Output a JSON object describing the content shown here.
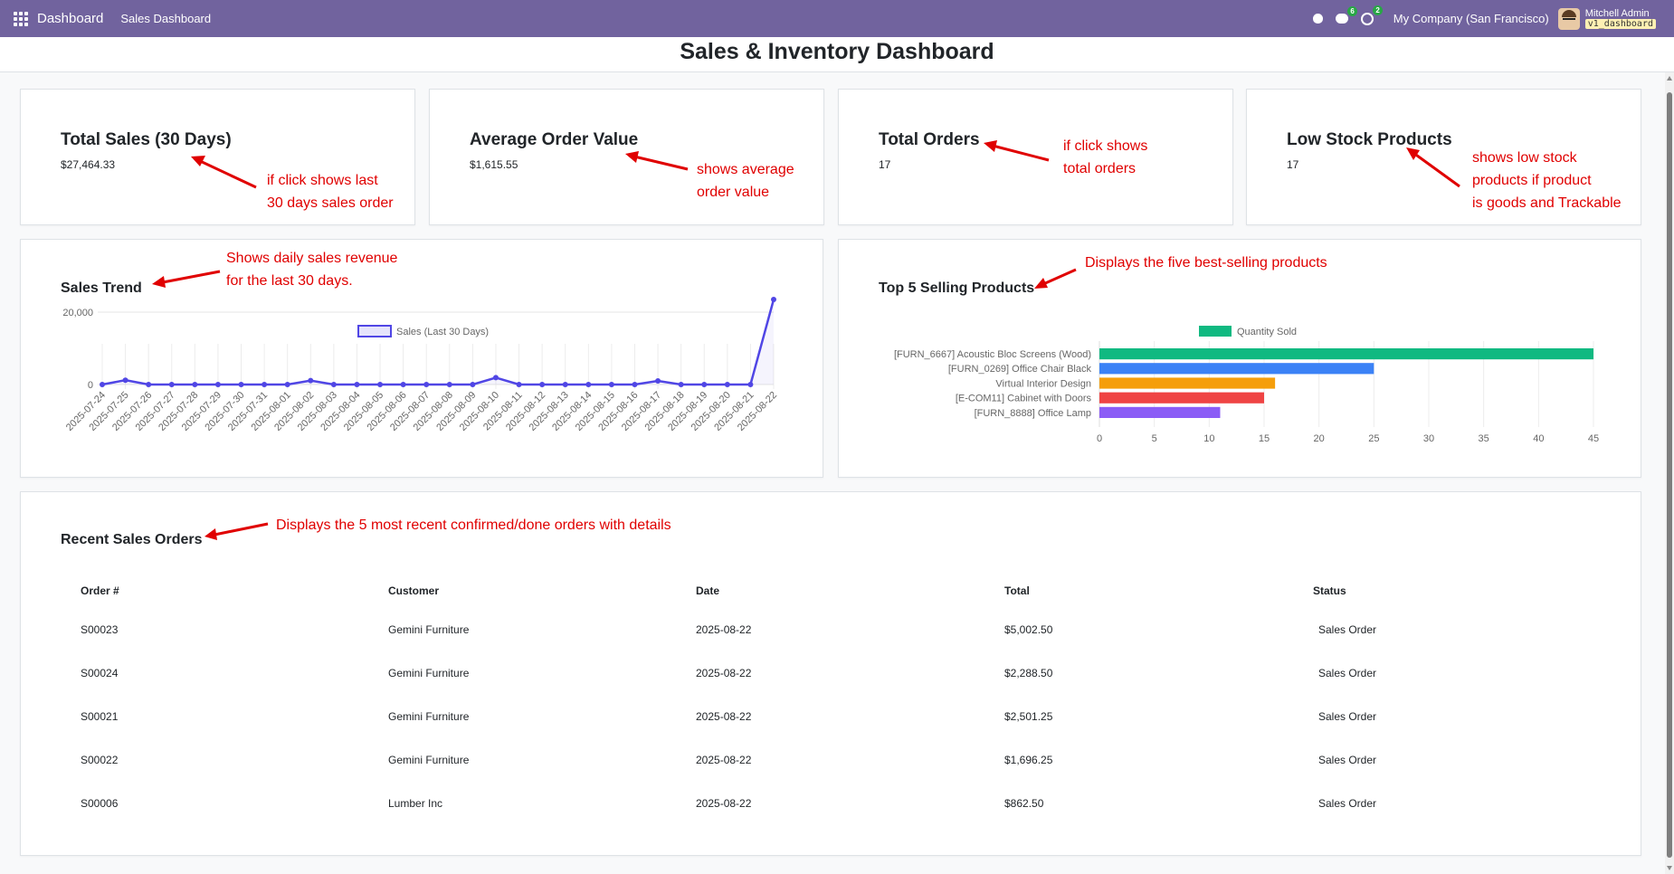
{
  "navbar": {
    "app_name": "Dashboard",
    "menu_item": "Sales Dashboard",
    "chat_badge": "6",
    "activity_badge": "2",
    "company": "My Company (San Francisco)",
    "user_name": "Mitchell Admin",
    "db_name": "v1_dashboard"
  },
  "page": {
    "title": "Sales & Inventory Dashboard"
  },
  "kpis": [
    {
      "title": "Total Sales (30 Days)",
      "value": "$27,464.33",
      "annotation": [
        "if click shows last",
        "30 days sales order"
      ]
    },
    {
      "title": "Average Order Value",
      "value": "$1,615.55",
      "annotation": [
        "shows average",
        "order value"
      ]
    },
    {
      "title": "Total Orders",
      "value": "17",
      "annotation": [
        "if click shows",
        "total orders"
      ]
    },
    {
      "title": "Low Stock Products",
      "value": "17",
      "annotation": [
        "shows low stock",
        "products if product",
        "is goods and Trackable"
      ]
    }
  ],
  "sales_trend": {
    "title": "Sales Trend",
    "annotation": [
      "Shows daily sales revenue",
      "for the last 30 days."
    ]
  },
  "top_products": {
    "title": "Top 5 Selling Products",
    "annotation": "Displays the five best-selling products"
  },
  "recent_orders": {
    "title": "Recent Sales Orders",
    "annotation": "Displays the 5 most recent confirmed/done orders with details",
    "columns": [
      "Order #",
      "Customer",
      "Date",
      "Total",
      "Status"
    ],
    "rows": [
      [
        "S00023",
        "Gemini Furniture",
        "2025-08-22",
        "$5,002.50",
        "Sales Order"
      ],
      [
        "S00024",
        "Gemini Furniture",
        "2025-08-22",
        "$2,288.50",
        "Sales Order"
      ],
      [
        "S00021",
        "Gemini Furniture",
        "2025-08-22",
        "$2,501.25",
        "Sales Order"
      ],
      [
        "S00022",
        "Gemini Furniture",
        "2025-08-22",
        "$1,696.25",
        "Sales Order"
      ],
      [
        "S00006",
        "Lumber Inc",
        "2025-08-22",
        "$862.50",
        "Sales Order"
      ]
    ]
  },
  "colors": {
    "navbar": "#71639e",
    "annotation": "#e00000",
    "line": "#5046e5"
  },
  "chart_data": [
    {
      "type": "line",
      "series": [
        {
          "name": "Sales (Last 30 Days)",
          "values": [
            0,
            1200,
            0,
            0,
            0,
            0,
            0,
            0,
            0,
            1100,
            0,
            0,
            0,
            0,
            0,
            0,
            0,
            1900,
            0,
            0,
            0,
            0,
            0,
            0,
            1000,
            0,
            0,
            0,
            0,
            0,
            23500
          ]
        }
      ],
      "x": [
        "2025-07-24",
        "2025-07-25",
        "2025-07-26",
        "2025-07-27",
        "2025-07-28",
        "2025-07-29",
        "2025-07-30",
        "2025-07-31",
        "2025-08-01",
        "2025-08-02",
        "2025-08-03",
        "2025-08-04",
        "2025-08-05",
        "2025-08-06",
        "2025-08-07",
        "2025-08-08",
        "2025-08-09",
        "2025-08-10",
        "2025-08-11",
        "2025-08-12",
        "2025-08-13",
        "2025-08-14",
        "2025-08-15",
        "2025-08-16",
        "2025-08-17",
        "2025-08-18",
        "2025-08-19",
        "2025-08-20",
        "2025-08-21",
        "2025-08-22"
      ],
      "yticks": [
        0,
        20000
      ],
      "ylim": [
        0,
        25000
      ],
      "legend": "top",
      "grid": true
    },
    {
      "type": "bar",
      "orientation": "horizontal",
      "categories": [
        "[FURN_6667] Acoustic Bloc Screens (Wood)",
        "[FURN_0269] Office Chair Black",
        "Virtual Interior Design",
        "[E-COM11] Cabinet with Doors",
        "[FURN_8888] Office Lamp"
      ],
      "series": [
        {
          "name": "Quantity Sold",
          "values": [
            45,
            25,
            16,
            15,
            11
          ]
        }
      ],
      "bar_colors": [
        "#10b981",
        "#3b82f6",
        "#f59e0b",
        "#ef4444",
        "#8b5cf6"
      ],
      "xticks": [
        0,
        5,
        10,
        15,
        20,
        25,
        30,
        35,
        40,
        45
      ],
      "xlim": [
        0,
        45
      ],
      "legend": "top",
      "grid": true
    }
  ]
}
